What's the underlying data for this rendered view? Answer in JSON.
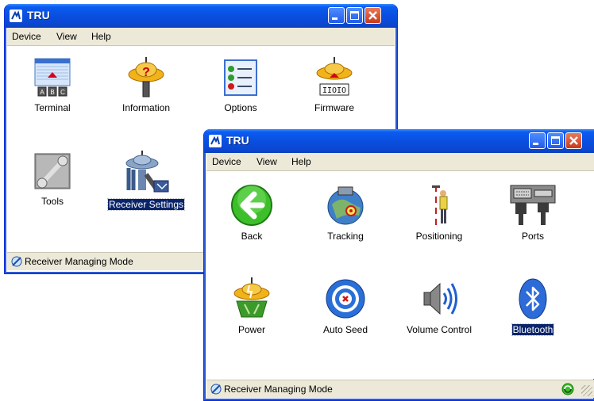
{
  "window_back": {
    "title": "TRU",
    "menu": [
      "Device",
      "View",
      "Help"
    ],
    "items": [
      {
        "label": "Terminal",
        "icon": "terminal-icon"
      },
      {
        "label": "Information",
        "icon": "information-icon"
      },
      {
        "label": "Options",
        "icon": "options-icon"
      },
      {
        "label": "Firmware",
        "icon": "firmware-icon"
      },
      {
        "label": "Tools",
        "icon": "tools-icon"
      },
      {
        "label": "Receiver Settings",
        "icon": "receiver-settings-icon",
        "selected": true
      }
    ],
    "status": "Receiver Managing Mode"
  },
  "window_front": {
    "title": "TRU",
    "menu": [
      "Device",
      "View",
      "Help"
    ],
    "items": [
      {
        "label": "Back",
        "icon": "back-arrow-icon"
      },
      {
        "label": "Tracking",
        "icon": "tracking-icon"
      },
      {
        "label": "Positioning",
        "icon": "positioning-icon"
      },
      {
        "label": "Ports",
        "icon": "ports-icon"
      },
      {
        "label": "Power",
        "icon": "power-icon"
      },
      {
        "label": "Auto Seed",
        "icon": "auto-seed-icon"
      },
      {
        "label": "Volume Control",
        "icon": "volume-icon"
      },
      {
        "label": "Bluetooth",
        "icon": "bluetooth-icon",
        "selected": true
      }
    ],
    "status": "Receiver Managing Mode"
  },
  "colors": {
    "title_blue": "#0b4fe0",
    "selection": "#0a246a",
    "chrome": "#ece9d8"
  }
}
